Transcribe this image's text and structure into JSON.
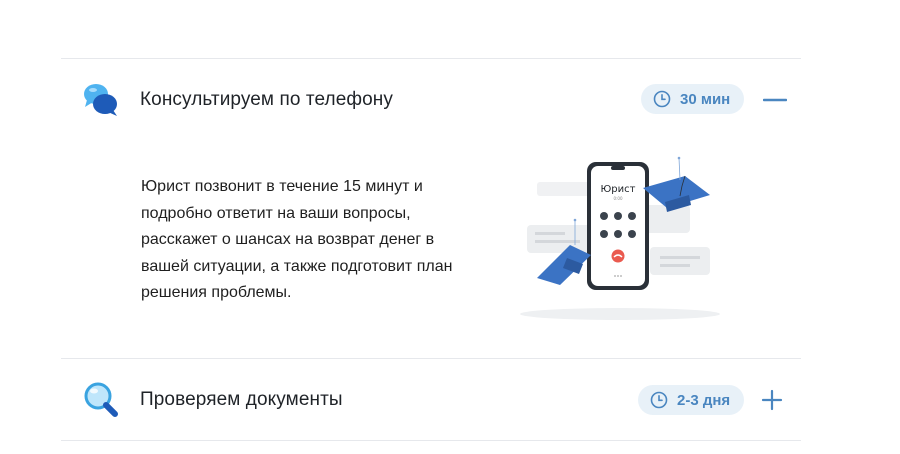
{
  "accordion": [
    {
      "title": "Консультируем по телефону",
      "duration": "30 мин",
      "expanded": true,
      "toggle_icon": "minus-icon",
      "icon": "chat-bubbles-icon",
      "description": "Юрист позвонит в течение 15 минут и подробно ответит на ваши вопросы, расскажет о шансах на возврат денег в вашей ситуации, а также подготовит план решения проблемы.",
      "illustration": {
        "caller_name": "Юрист",
        "call_timer": "0:00"
      }
    },
    {
      "title": "Проверяем документы",
      "duration": "2-3 дня",
      "expanded": false,
      "toggle_icon": "plus-icon",
      "icon": "magnifier-icon"
    }
  ],
  "colors": {
    "accent": "#4a86c0",
    "badge_bg": "#e8f1f8",
    "divider": "#e6e8ec"
  }
}
